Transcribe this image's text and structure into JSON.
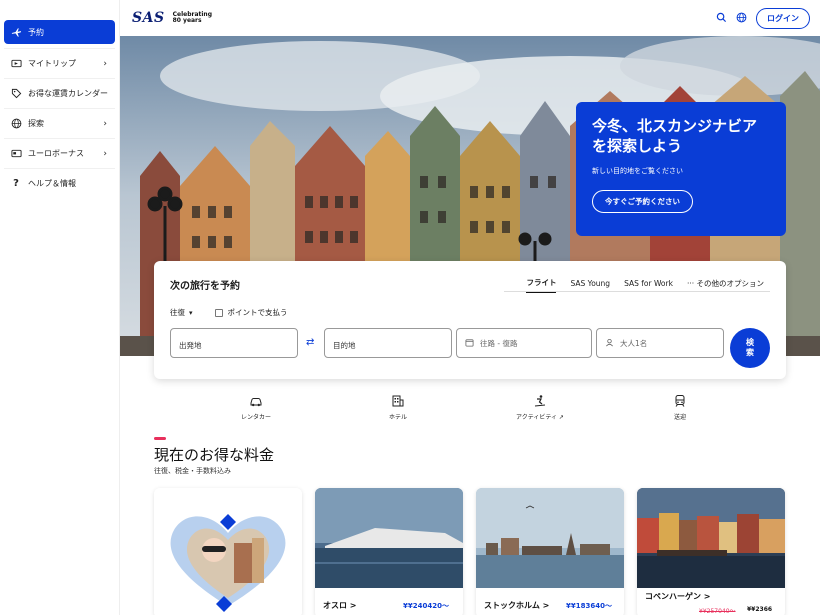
{
  "sidebar": {
    "items": [
      {
        "label": "予約",
        "icon": "airplane-icon",
        "active": true
      },
      {
        "label": "マイトリップ",
        "icon": "ticket-icon",
        "chevron": true
      },
      {
        "label": "お得な運賃カレンダー",
        "icon": "tag-icon"
      },
      {
        "label": "探索",
        "icon": "globe-icon",
        "chevron": true
      },
      {
        "label": "ユーロボーナス",
        "icon": "card-icon",
        "chevron": true
      },
      {
        "label": "ヘルプ＆情報",
        "icon": "question-icon"
      }
    ]
  },
  "header": {
    "logo": "SAS",
    "celebrating_line1": "Celebrating",
    "celebrating_line2": "80 years",
    "login_label": "ログイン"
  },
  "promo": {
    "title_line1": "今冬、北スカンジナビア",
    "title_line2": "を探索しよう",
    "subtitle": "新しい目的地をご覧ください",
    "button": "今すぐご予約ください"
  },
  "booking": {
    "title": "次の旅行を予約",
    "tabs": [
      "フライト",
      "SAS Young",
      "SAS for Work",
      "··· その他のオプション"
    ],
    "trip_type": "往復",
    "points_label": "ポイントで支払う",
    "origin_placeholder": "出発地",
    "destination_placeholder": "目的地",
    "dates_placeholder": "往路 - 復路",
    "passengers": "大人1名",
    "search_line1": "検",
    "search_line2": "索"
  },
  "services": [
    {
      "label": "レンタカー",
      "icon": "car-icon"
    },
    {
      "label": "ホテル",
      "icon": "hotel-icon"
    },
    {
      "label": "アクティビティ ",
      "icon": "ski-icon"
    },
    {
      "label": "送迎",
      "icon": "train-icon"
    }
  ],
  "deals": {
    "title": "現在のお得な料金",
    "subtitle": "往復、税金・手数料込み",
    "cards": [
      {
        "city": "オスロ >",
        "price": "¥¥240420〜"
      },
      {
        "city": "ストックホルム >",
        "price": "¥¥183640〜"
      },
      {
        "city": "コペンハーゲン >",
        "old_price": "¥¥257040〜",
        "new_price": "¥¥2366"
      }
    ]
  },
  "colors": {
    "brand_blue": "#0a3dd6",
    "accent_pink": "#e8305c",
    "logo_navy": "#0a1e73"
  }
}
